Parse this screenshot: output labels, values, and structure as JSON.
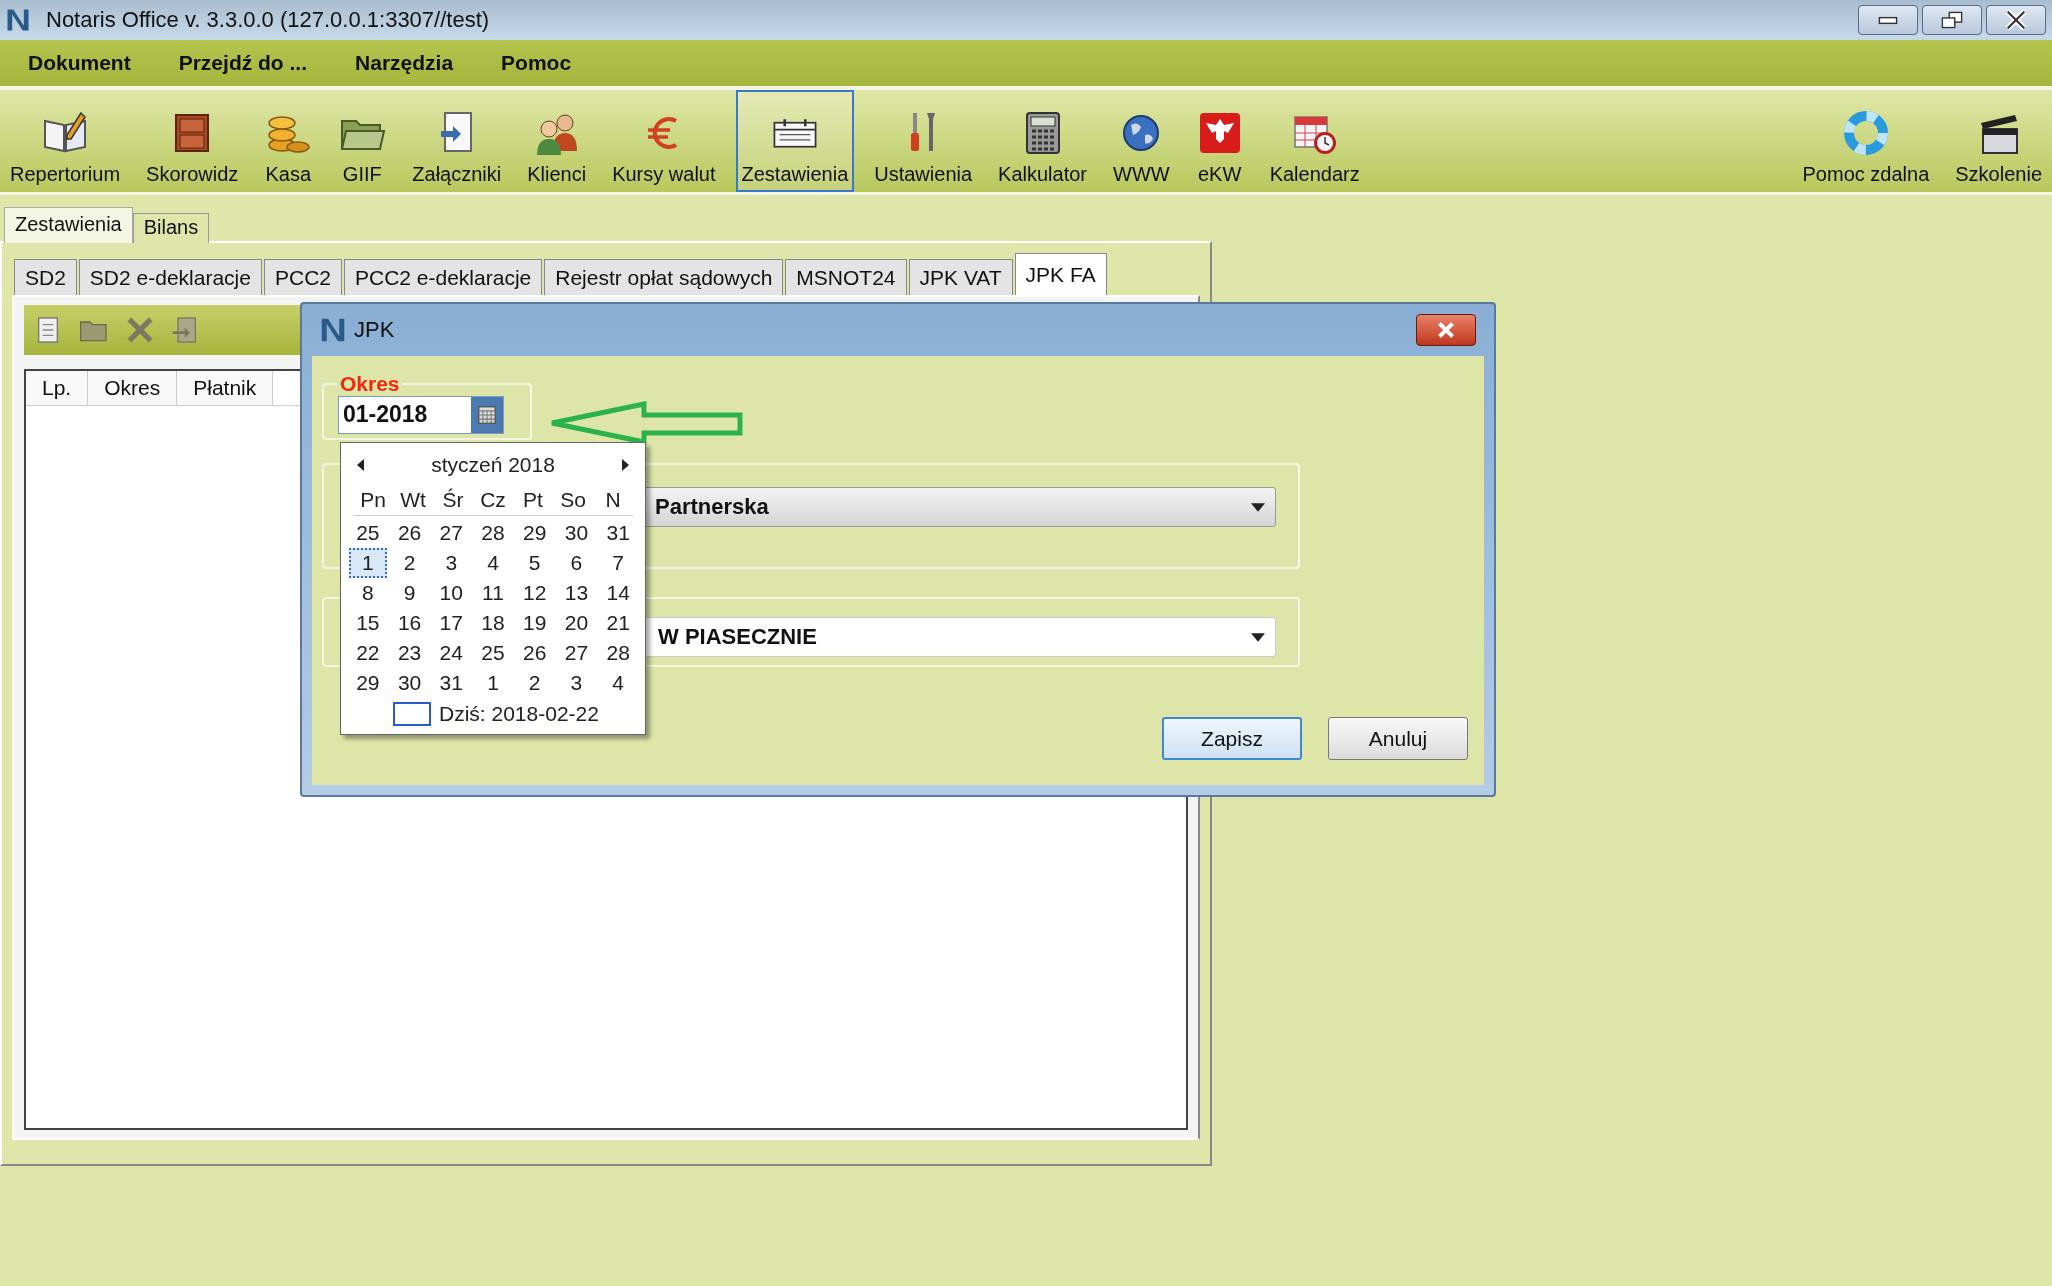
{
  "window": {
    "title": "Notaris Office v. 3.3.0.0 (127.0.0.1:3307//test)"
  },
  "menu": [
    "Dokument",
    "Przejdź do ...",
    "Narzędzia",
    "Pomoc"
  ],
  "toolbar": [
    {
      "label": "Repertorium",
      "kind": "book",
      "selected": false
    },
    {
      "label": "Skorowidz",
      "kind": "cabinet",
      "selected": false
    },
    {
      "label": "Kasa",
      "kind": "coins",
      "selected": false
    },
    {
      "label": "GIIF",
      "kind": "folder",
      "selected": false
    },
    {
      "label": "Załączniki",
      "kind": "attachment",
      "selected": false
    },
    {
      "label": "Klienci",
      "kind": "people",
      "selected": false
    },
    {
      "label": "Kursy walut",
      "kind": "euro",
      "selected": false
    },
    {
      "label": "Zestawienia",
      "kind": "report",
      "selected": true
    },
    {
      "label": "Ustawienia",
      "kind": "tools",
      "selected": false
    },
    {
      "label": "Kalkulator",
      "kind": "calculator",
      "selected": false
    },
    {
      "label": "WWW",
      "kind": "globe",
      "selected": false
    },
    {
      "label": "eKW",
      "kind": "emblem",
      "selected": false
    },
    {
      "label": "Kalendarz",
      "kind": "calendar",
      "selected": false
    }
  ],
  "toolbar_right": [
    {
      "label": "Pomoc zdalna",
      "kind": "lifebuoy",
      "selected": false
    },
    {
      "label": "Szkolenie",
      "kind": "clapperboard",
      "selected": false
    }
  ],
  "main_tabs": [
    {
      "label": "Zestawienia",
      "selected": true
    },
    {
      "label": "Bilans",
      "selected": false
    }
  ],
  "report_tabs": [
    {
      "label": "SD2",
      "selected": false
    },
    {
      "label": "SD2 e-deklaracje",
      "selected": false
    },
    {
      "label": "PCC2",
      "selected": false
    },
    {
      "label": "PCC2 e-deklaracje",
      "selected": false
    },
    {
      "label": "Rejestr opłat sądowych",
      "selected": false
    },
    {
      "label": "MSNOT24",
      "selected": false
    },
    {
      "label": "JPK VAT",
      "selected": false
    },
    {
      "label": "JPK FA",
      "selected": true
    }
  ],
  "list": {
    "columns": [
      "Lp.",
      "Okres",
      "Płatnik"
    ]
  },
  "dialog": {
    "title": "JPK",
    "period": {
      "legend": "Okres",
      "value": "01-2018"
    },
    "combos": [
      {
        "kind": "dropdown",
        "value": "Partnerska"
      },
      {
        "kind": "editable",
        "value": "W PIASECZNIE"
      }
    ],
    "buttons": [
      {
        "label": "Zapisz",
        "default": true
      },
      {
        "label": "Anuluj",
        "default": false
      }
    ]
  },
  "calendar": {
    "month": "styczeń 2018",
    "weekdays": [
      "Pn",
      "Wt",
      "Śr",
      "Cz",
      "Pt",
      "So",
      "N"
    ],
    "weeks": [
      [
        {
          "day": "25",
          "selected": false
        },
        {
          "day": "26",
          "selected": false
        },
        {
          "day": "27",
          "selected": false
        },
        {
          "day": "28",
          "selected": false
        },
        {
          "day": "29",
          "selected": false
        },
        {
          "day": "30",
          "selected": false
        },
        {
          "day": "31",
          "selected": false
        }
      ],
      [
        {
          "day": "1",
          "selected": true
        },
        {
          "day": "2",
          "selected": false
        },
        {
          "day": "3",
          "selected": false
        },
        {
          "day": "4",
          "selected": false
        },
        {
          "day": "5",
          "selected": false
        },
        {
          "day": "6",
          "selected": false
        },
        {
          "day": "7",
          "selected": false
        }
      ],
      [
        {
          "day": "8",
          "selected": false
        },
        {
          "day": "9",
          "selected": false
        },
        {
          "day": "10",
          "selected": false
        },
        {
          "day": "11",
          "selected": false
        },
        {
          "day": "12",
          "selected": false
        },
        {
          "day": "13",
          "selected": false
        },
        {
          "day": "14",
          "selected": false
        }
      ],
      [
        {
          "day": "15",
          "selected": false
        },
        {
          "day": "16",
          "selected": false
        },
        {
          "day": "17",
          "selected": false
        },
        {
          "day": "18",
          "selected": false
        },
        {
          "day": "19",
          "selected": false
        },
        {
          "day": "20",
          "selected": false
        },
        {
          "day": "21",
          "selected": false
        }
      ],
      [
        {
          "day": "22",
          "selected": false
        },
        {
          "day": "23",
          "selected": false
        },
        {
          "day": "24",
          "selected": false
        },
        {
          "day": "25",
          "selected": false
        },
        {
          "day": "26",
          "selected": false
        },
        {
          "day": "27",
          "selected": false
        },
        {
          "day": "28",
          "selected": false
        }
      ],
      [
        {
          "day": "29",
          "selected": false
        },
        {
          "day": "30",
          "selected": false
        },
        {
          "day": "31",
          "selected": false
        },
        {
          "day": "1",
          "selected": false
        },
        {
          "day": "2",
          "selected": false
        },
        {
          "day": "3",
          "selected": false
        },
        {
          "day": "4",
          "selected": false
        }
      ]
    ],
    "today": "Dziś: 2018-02-22"
  }
}
